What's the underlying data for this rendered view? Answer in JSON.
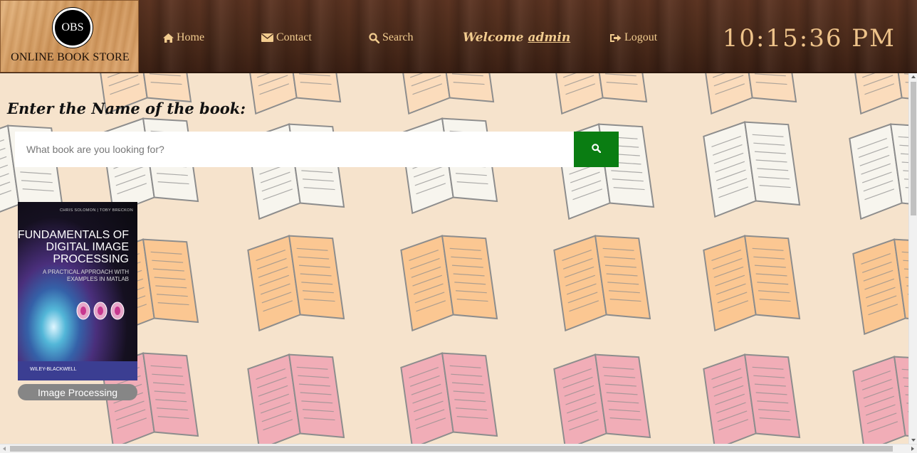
{
  "header": {
    "logo_badge": "OBS",
    "logo_text": "ONLINE BOOK STORE",
    "nav": [
      {
        "label": "Home",
        "icon": "home-icon"
      },
      {
        "label": "Contact",
        "icon": "envelope-icon"
      },
      {
        "label": "Search",
        "icon": "search-icon"
      },
      {
        "label": "Logout",
        "icon": "logout-icon"
      }
    ],
    "welcome_prefix": "Welcome",
    "welcome_user": "admin",
    "clock": "10:15:36 PM"
  },
  "search": {
    "heading": "Enter the Name of the book:",
    "placeholder": "What book are you looking for?",
    "value": ""
  },
  "books": [
    {
      "caption": "Image Processing",
      "cover": {
        "authors": "CHRIS SOLOMON | TOBY BRECKON",
        "title": "FUNDAMENTALS OF DIGITAL IMAGE PROCESSING",
        "subtitle": "A PRACTICAL APPROACH WITH EXAMPLES IN MATLAB",
        "publisher": "WILEY-BLACKWELL"
      }
    }
  ],
  "colors": {
    "header_text": "#f2cc8f",
    "search_button": "#0a7d12",
    "background": "#f6e3cc"
  }
}
